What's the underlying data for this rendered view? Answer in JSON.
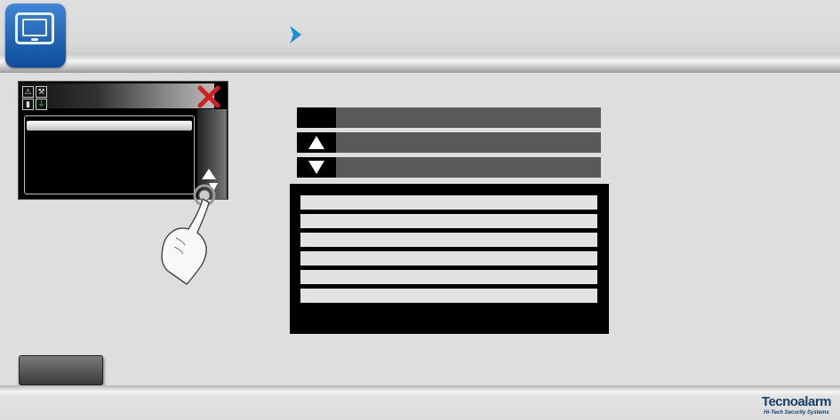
{
  "header": {
    "app_icon": "keypad-display-icon",
    "breadcrumb_arrow_icon": "chevron-right-icon",
    "accent_color": "#1a8fd8"
  },
  "keypad_preview": {
    "status_icons": [
      "warning-icon",
      "hammer-icon",
      "lock-icon",
      "plug-icon"
    ],
    "close_icon": "close-x-icon",
    "close_color": "#d21f1f",
    "scroll_icons": [
      "arrow-up-icon",
      "arrow-down-icon"
    ],
    "pointer_icon": "hand-pointer-icon"
  },
  "controls": {
    "row1": {
      "button_icon": "",
      "label": ""
    },
    "row2": {
      "button_icon": "arrow-up-icon",
      "label": ""
    },
    "row3": {
      "button_icon": "arrow-down-icon",
      "label": ""
    }
  },
  "list": {
    "items": [
      "",
      "",
      "",
      "",
      "",
      ""
    ]
  },
  "footer": {
    "brand_name": "Tecnoalarm",
    "brand_tagline": "Hi-Tech Security Systems",
    "brand_color": "#15406e"
  },
  "bottom_button": {
    "label": ""
  }
}
